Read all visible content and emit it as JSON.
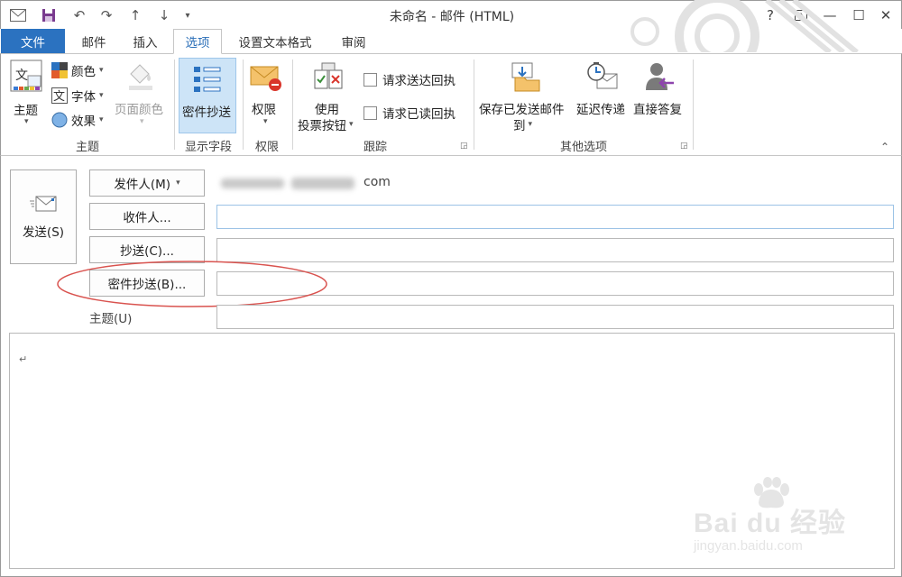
{
  "window": {
    "title": "未命名 - 邮件 (HTML)",
    "help": "?",
    "controls": {
      "restore_ribbon": "⊼",
      "minimize": "—",
      "maximize": "☐",
      "close": "✕"
    }
  },
  "tabs": [
    {
      "label": "文件",
      "kind": "file"
    },
    {
      "label": "邮件"
    },
    {
      "label": "插入"
    },
    {
      "label": "选项",
      "active": true
    },
    {
      "label": "设置文本格式"
    },
    {
      "label": "审阅"
    }
  ],
  "ribbon": {
    "themes_group": {
      "label": "主题",
      "theme_button": "主题",
      "colors": "颜色",
      "fonts": "字体",
      "effects": "效果",
      "page_color": "页面颜色"
    },
    "show_fields_group": {
      "label": "显示字段",
      "bcc_button": "密件抄送"
    },
    "permission_group": {
      "label": "权限",
      "permission_button": "权限"
    },
    "tracking_group": {
      "label": "跟踪",
      "voting_line1": "使用",
      "voting_line2": "投票按钮",
      "delivery_receipt": "请求送达回执",
      "read_receipt": "请求已读回执"
    },
    "more_options_group": {
      "label": "其他选项",
      "save_sent_line1": "保存已发送邮件",
      "save_sent_line2": "到",
      "delay_delivery": "延迟传递",
      "direct_replies": "直接答复"
    }
  },
  "form": {
    "send_button": "发送(S)",
    "from_button": "发件人(M)",
    "from_value_visible": "com",
    "to_button": "收件人...",
    "cc_button": "抄送(C)...",
    "bcc_button": "密件抄送(B)...",
    "subject_label": "主题(U)",
    "to_value": "",
    "cc_value": "",
    "bcc_value": "",
    "subject_value": "",
    "body_mark": "↵"
  },
  "watermark": {
    "brand": "Bai du 经验",
    "url": "jingyan.baidu.com"
  },
  "colors": {
    "file_tab": "#2b72c0",
    "active_tab_text": "#2b6fb8",
    "selected_ribbon_button": "#cde4f7",
    "annotation_circle": "#d9534f"
  }
}
